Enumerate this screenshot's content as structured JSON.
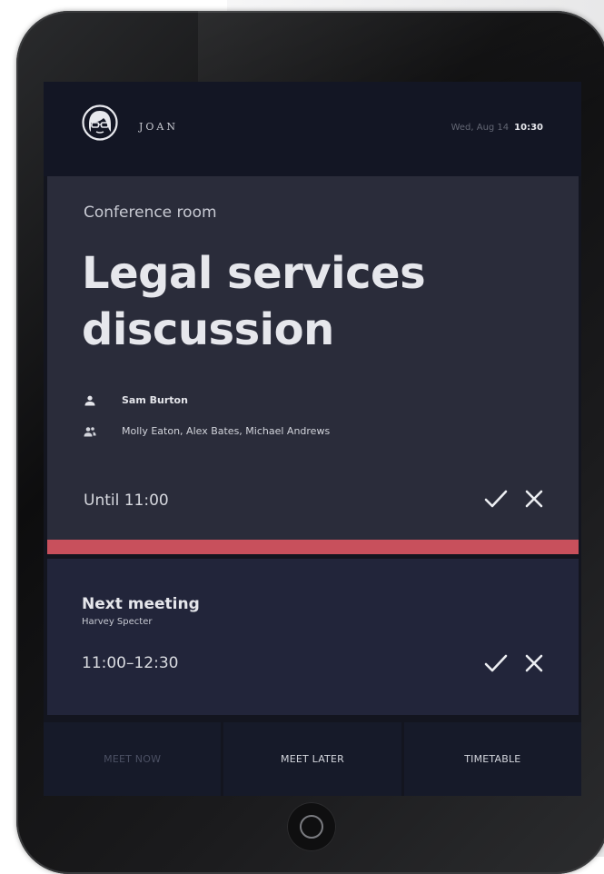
{
  "header": {
    "brand": "JOAN",
    "date": "Wed, Aug 14",
    "time": "10:30"
  },
  "current_meeting": {
    "room": "Conference room",
    "title": "Legal services discussion",
    "organizer": "Sam Burton",
    "attendees": "Molly Eaton, Alex Bates, Michael Andrews",
    "until": "Until 11:00"
  },
  "next_meeting": {
    "label": "Next meeting",
    "organizer": "Harvey Specter",
    "time_range": "11:00–12:30"
  },
  "footer": {
    "meet_now": "MEET NOW",
    "meet_later": "MEET LATER",
    "timetable": "TIMETABLE"
  },
  "colors": {
    "accent_bar": "#c8505c",
    "background": "#13151f",
    "card": "#2a2c3a"
  }
}
